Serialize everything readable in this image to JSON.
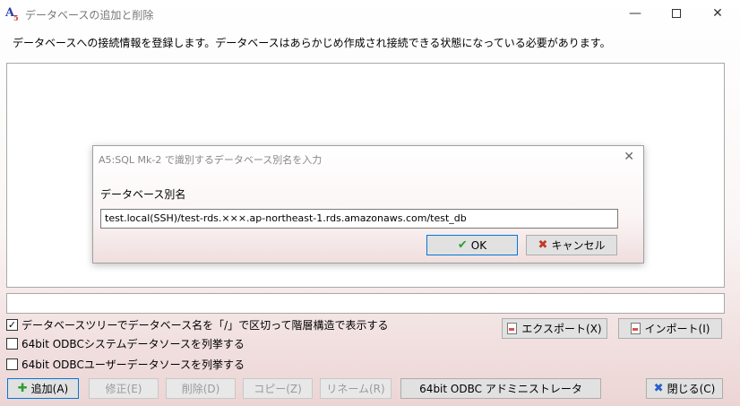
{
  "window": {
    "title": "データベースの追加と削除",
    "minimize": "—",
    "close": "✕"
  },
  "description": "データベースへの接続情報を登録します。データベースはあらかじめ作成され接続できる状態になっている必要があります。",
  "options": {
    "tree_split": {
      "label": "データベースツリーでデータベース名を「/」で区切って階層構造で表示する",
      "checked": true
    },
    "odbc_system": {
      "label": "64bit ODBCシステムデータソースを列挙する",
      "checked": false
    },
    "odbc_user": {
      "label": "64bit ODBCユーザーデータソースを列挙する",
      "checked": false
    }
  },
  "buttons": {
    "export": "エクスポート(X)",
    "import": "インポート(I)",
    "add": "追加(A)",
    "edit": "修正(E)",
    "delete": "削除(D)",
    "copy": "コピー(Z)",
    "rename": "リネーム(R)",
    "odbc_admin": "64bit ODBC アドミニストレータ",
    "close": "閉じる(C)"
  },
  "dialog": {
    "title": "A5:SQL Mk-2 で識別するデータベース別名を入力",
    "close": "✕",
    "label": "データベース別名",
    "value": "test.local(SSH)/test-rds.×××.ap-northeast-1.rds.amazonaws.com/test_db",
    "ok": "OK",
    "cancel": "キャンセル"
  },
  "icons": {
    "checked_mark": "✓",
    "plus": "✚",
    "x": "✖",
    "check": "✔",
    "cross": "✖"
  }
}
